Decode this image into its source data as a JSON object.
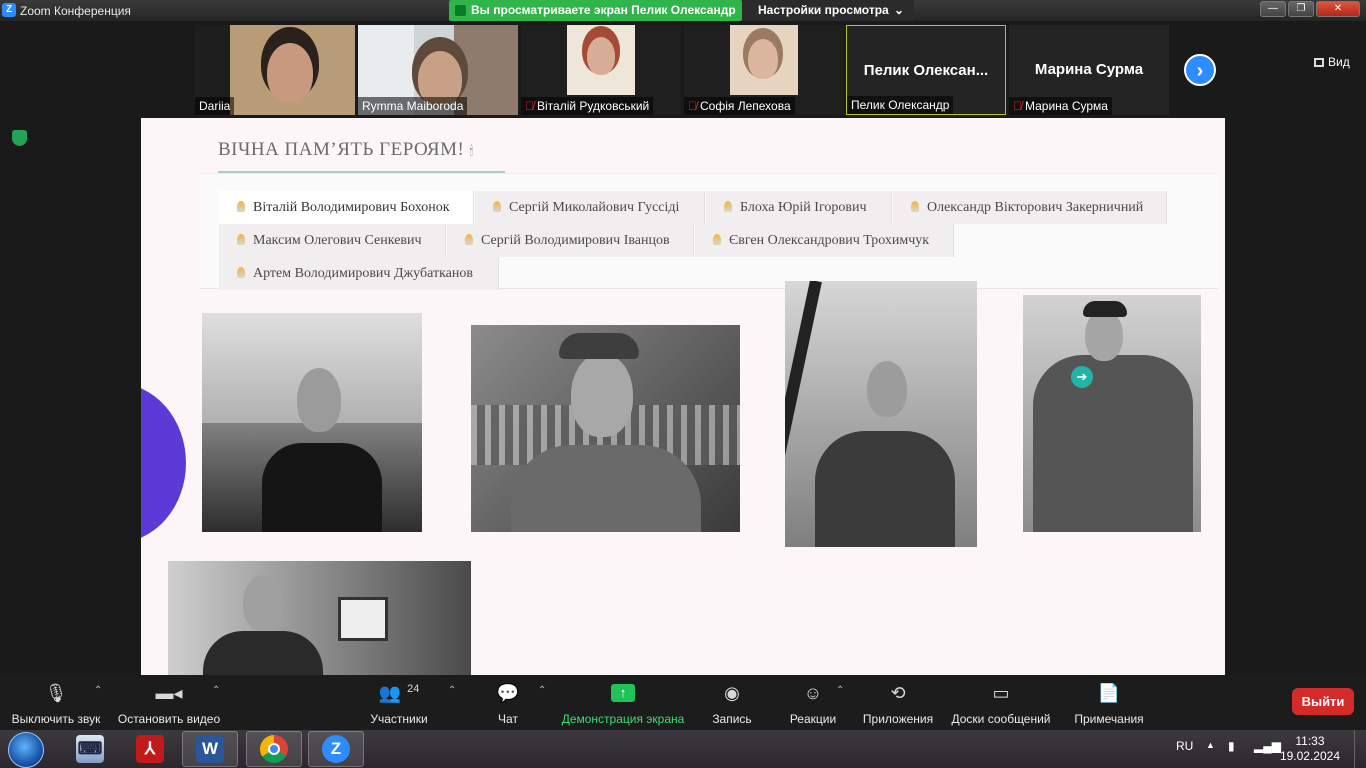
{
  "titlebar": {
    "app_icon": "Z",
    "title": "Zoom Конференция",
    "share_status": "Вы просматриваете экран Пелик Олександр",
    "view_options": "Настройки просмотра",
    "win_min": "—",
    "win_max": "❐",
    "win_close": "✕"
  },
  "gallery": {
    "participants": [
      {
        "name": "Dariia",
        "muted": false
      },
      {
        "name": "Rymma Maiboroda",
        "muted": false
      },
      {
        "name": "Віталій Рудковський",
        "muted": true
      },
      {
        "name": "Софія Лепехова",
        "muted": true
      },
      {
        "name": "Пелик Олександр",
        "display": "Пелик  Олексан...",
        "muted": false,
        "active": true
      },
      {
        "name": "Марина Сурма",
        "display": "Марина Сурма",
        "muted": true
      }
    ],
    "next_arrow": "›",
    "view_label": "Вид"
  },
  "shared_page": {
    "heading": "ВІЧНА ПАМ’ЯТЬ ГЕРОЯМ!",
    "heading_icon": "🕯",
    "tabs": [
      "Віталій Володимирович Бохонок",
      "Сергій Миколайович Гуссіді",
      "Блоха Юрій Ігорович",
      "Олександр Вікторович Закерничний",
      "Максим Олегович Сенкевич",
      "Сергій Володимирович Іванцов",
      "Євген Олександрович Трохимчук",
      "Артем Володимирович Джубатканов"
    ],
    "selected_tab": 0,
    "cursor_icon": "arrow-right-circle-icon"
  },
  "toolbar": {
    "mute": "Выключить звук",
    "video": "Остановить видео",
    "participants": "Участники",
    "participants_count": "24",
    "chat": "Чат",
    "share": "Демонстрация экрана",
    "record": "Запись",
    "reactions": "Реакции",
    "apps": "Приложения",
    "whiteboards": "Доски сообщений",
    "notes": "Примечания",
    "leave": "Выйти",
    "colors": {
      "share_green": "#22c25a",
      "leave_red": "#d32a2a",
      "zoom_blue": "#2d8cff"
    }
  },
  "taskbar": {
    "lang": "RU",
    "time": "11:33",
    "date": "19.02.2024",
    "apps": [
      "keyboard-app",
      "acrobat",
      "word",
      "chrome",
      "zoom"
    ]
  }
}
